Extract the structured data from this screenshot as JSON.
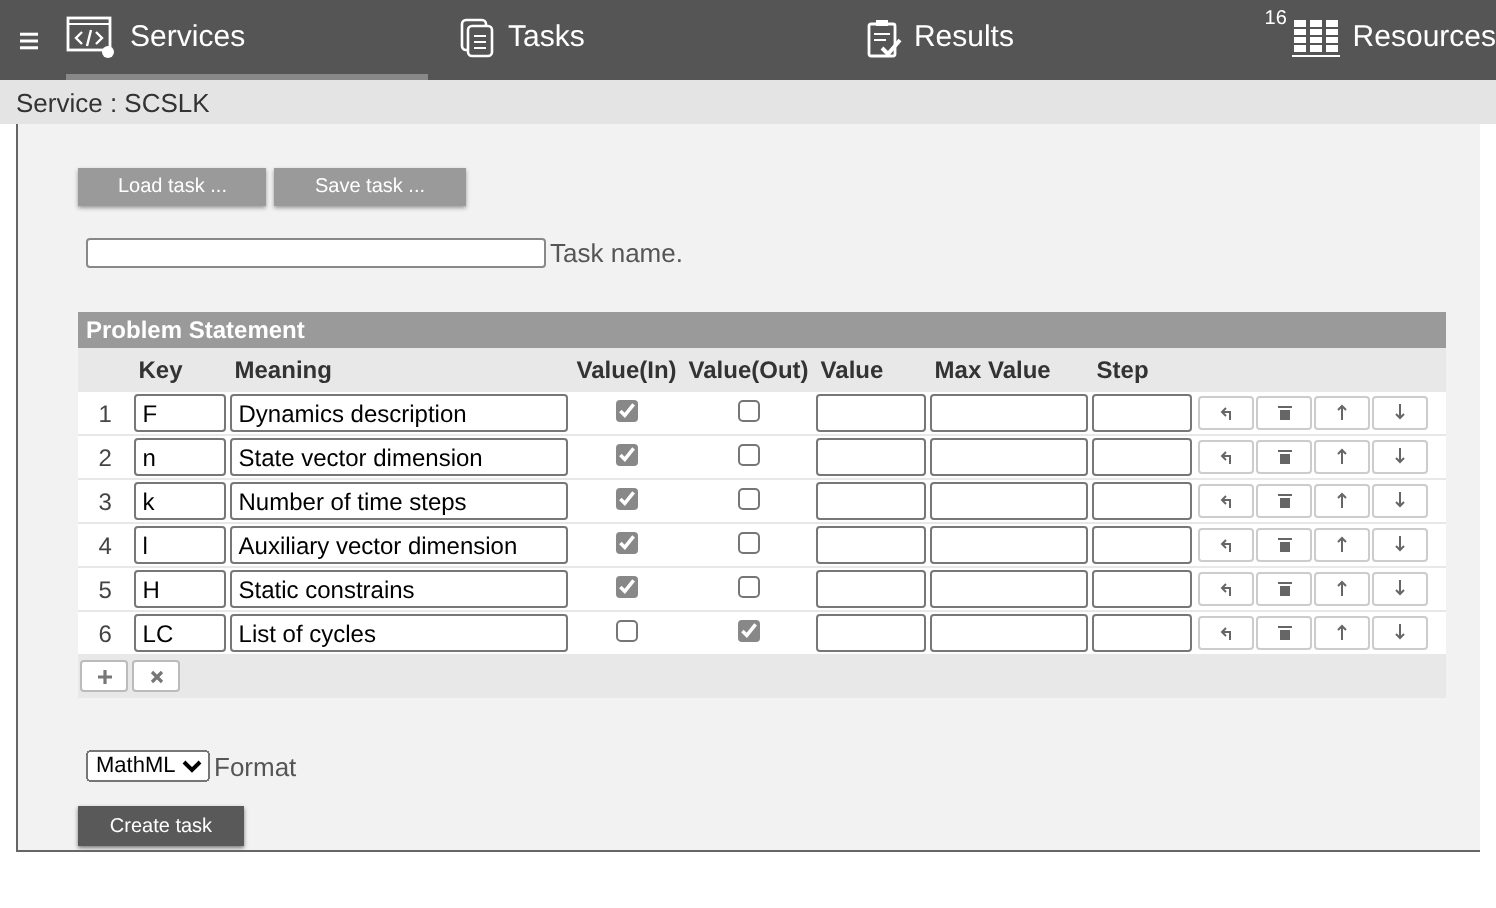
{
  "nav": {
    "tabs": [
      {
        "label": "Services",
        "kind": "services",
        "selected": true
      },
      {
        "label": "Tasks",
        "kind": "tasks",
        "selected": false
      },
      {
        "label": "Results",
        "kind": "results",
        "selected": false
      },
      {
        "label": "Resources",
        "kind": "resources",
        "selected": false,
        "badge": "16"
      }
    ]
  },
  "service_label": "Service : SCSLK",
  "buttons": [
    "Load task ...",
    "Save task ..."
  ],
  "task_name": {
    "label": "Task name."
  },
  "table": {
    "title": "Problem Statement",
    "columns": [
      "Key",
      "Meaning",
      "Value(In)",
      "Value(Out)",
      "Value",
      "Max Value",
      "Step"
    ],
    "rows": [
      {
        "number": "1",
        "key": "F",
        "meaning": "Dynamics description",
        "value_in": true,
        "value_out": false
      },
      {
        "number": "2",
        "key": "n",
        "meaning": "State vector dimension",
        "value_in": true,
        "value_out": false
      },
      {
        "number": "3",
        "key": "k",
        "meaning": "Number of time steps",
        "value_in": true,
        "value_out": false
      },
      {
        "number": "4",
        "key": "l",
        "meaning": "Auxiliary vector dimension",
        "value_in": true,
        "value_out": false
      },
      {
        "number": "5",
        "key": "H",
        "meaning": "Static constrains",
        "value_in": true,
        "value_out": false
      },
      {
        "number": "6",
        "key": "LC",
        "meaning": "List of cycles",
        "value_in": false,
        "value_out": true
      }
    ]
  },
  "format": {
    "value": "MathML",
    "label": "Format"
  },
  "create_button": "Create task"
}
